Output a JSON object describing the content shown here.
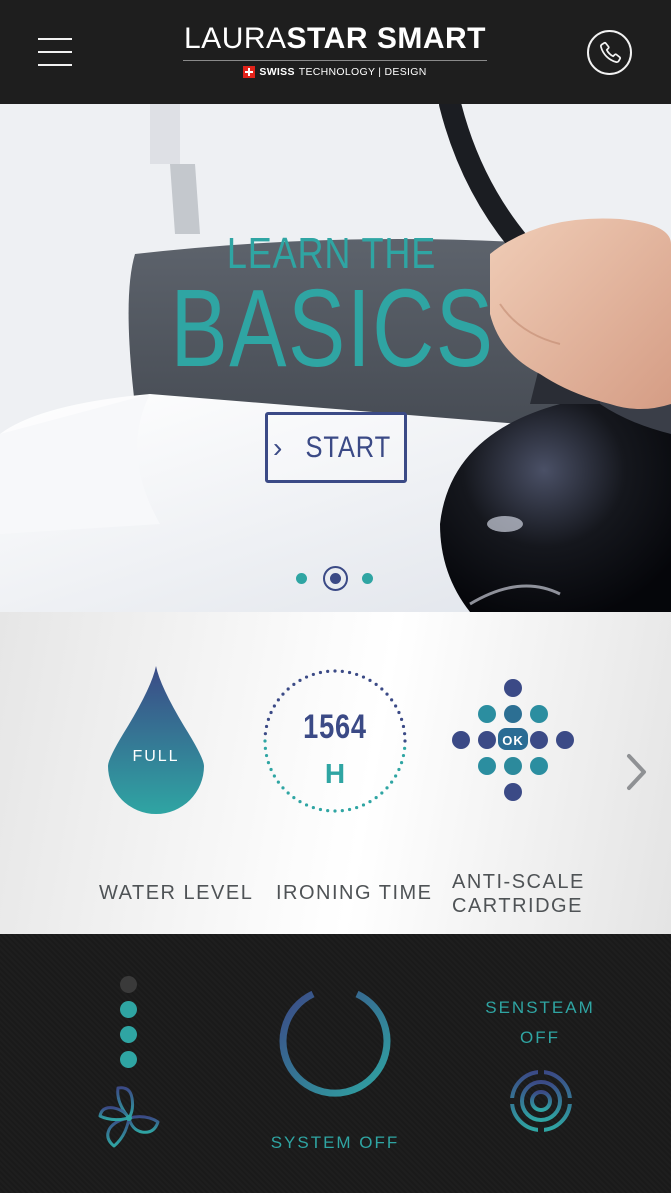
{
  "header": {
    "brand_light": "LAURA",
    "brand_bold": "STAR SMART",
    "tagline_bold": "SWISS",
    "tagline_rest": "TECHNOLOGY | DESIGN",
    "menu_icon": "hamburger-menu-icon",
    "phone_icon": "phone-icon"
  },
  "hero": {
    "line1": "LEARN THE",
    "line2": "BASICS",
    "start_label": "START",
    "carousel": {
      "count": 3,
      "active_index": 1
    }
  },
  "status": {
    "water": {
      "value": "FULL",
      "label": "WATER LEVEL"
    },
    "ironing": {
      "hours": "1564",
      "unit": "H",
      "label": "IRONING TIME"
    },
    "cartridge": {
      "value": "OK",
      "label_line1": "ANTI-SCALE",
      "label_line2": "CARTRIDGE"
    },
    "next_icon": "chevron-right-icon"
  },
  "controls": {
    "fan": {
      "levels_total": 4,
      "levels_active": 3,
      "icon": "fan-icon"
    },
    "power": {
      "label": "SYSTEM OFF",
      "icon": "power-icon"
    },
    "sensteam": {
      "label": "SENSTEAM",
      "state": "OFF",
      "icon": "target-icon"
    }
  },
  "colors": {
    "teal": "#2fa5a3",
    "navy": "#3b4a86",
    "header_bg": "#1e1e1e"
  }
}
